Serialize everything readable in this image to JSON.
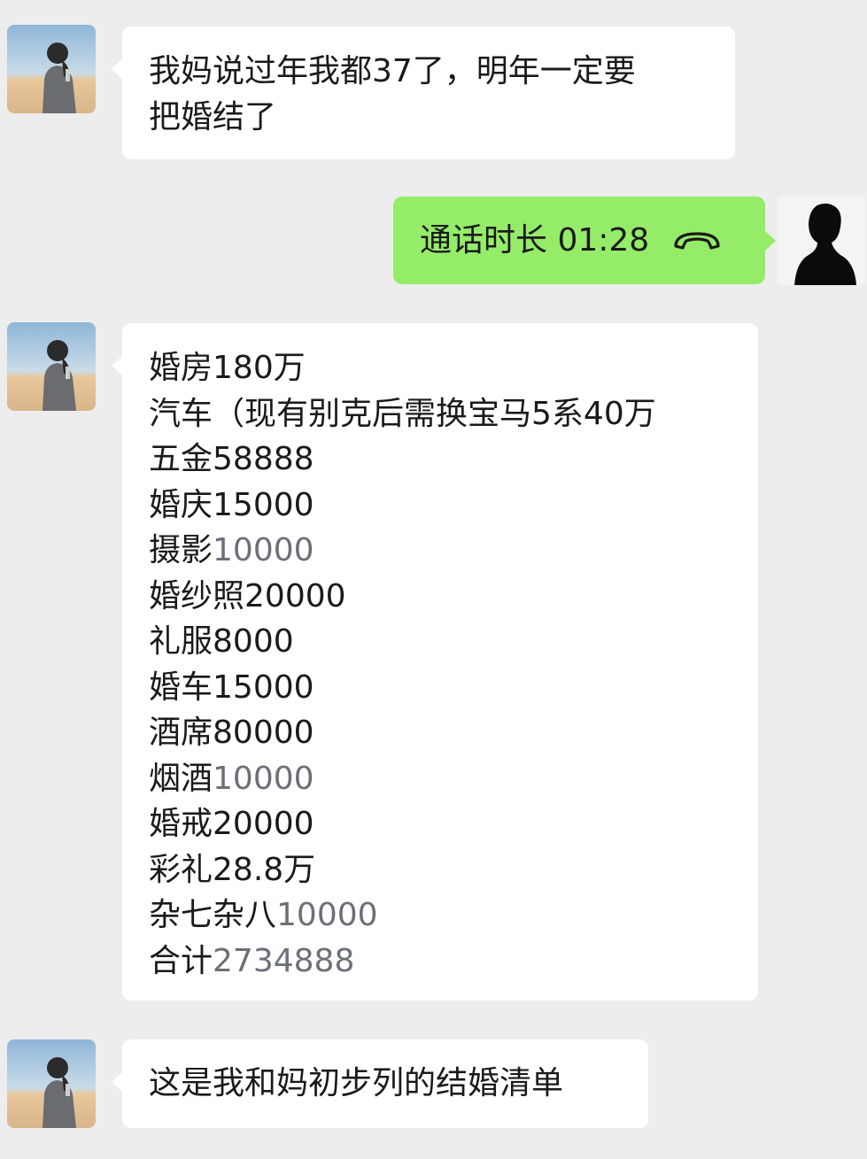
{
  "messages": [
    {
      "sender": "contact",
      "lines": [
        "我妈说过年我都37了，明年一定要",
        "把婚结了"
      ]
    },
    {
      "sender": "self",
      "call_label": "通话时长 01:28",
      "icon": "phone-hangup-icon"
    },
    {
      "sender": "contact",
      "items": [
        {
          "label": "婚房",
          "value": "180万"
        },
        {
          "label": "汽车",
          "value": "（现有别克后需换宝马5系40万"
        },
        {
          "label": "五金",
          "value": "58888"
        },
        {
          "label": "婚庆",
          "value": "15000"
        },
        {
          "label": "摄影",
          "value": "10000"
        },
        {
          "label": "婚纱照",
          "value": "20000"
        },
        {
          "label": "礼服",
          "value": "8000"
        },
        {
          "label": "婚车",
          "value": "15000"
        },
        {
          "label": "酒席",
          "value": "80000"
        },
        {
          "label": "烟酒",
          "value": "10000"
        },
        {
          "label": "婚戒",
          "value": "20000"
        },
        {
          "label": "彩礼",
          "value": "28.8万"
        },
        {
          "label": "杂七杂八",
          "value": "10000"
        },
        {
          "label": "合计",
          "value": "2734888"
        }
      ]
    },
    {
      "sender": "contact",
      "lines": [
        "这是我和妈初步列的结婚清单"
      ]
    }
  ],
  "colors": {
    "background": "#ededed",
    "bubble_incoming": "#ffffff",
    "bubble_outgoing": "#95ec69",
    "muted_number": "#6b6f78"
  }
}
